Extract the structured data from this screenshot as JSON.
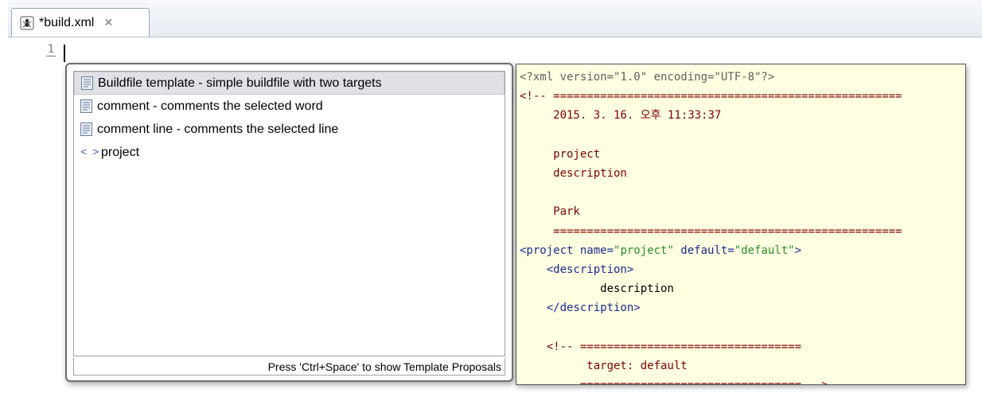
{
  "editor": {
    "tab_title": "*build.xml",
    "tab_close_glyph": "✕",
    "line_number": "1"
  },
  "proposals": {
    "items": [
      {
        "icon": "template-icon",
        "label": "Buildfile template - simple buildfile with two targets",
        "selected": true
      },
      {
        "icon": "template-icon",
        "label": "comment - comments the selected word",
        "selected": false
      },
      {
        "icon": "template-icon",
        "label": "comment line - comments the selected line",
        "selected": false
      },
      {
        "icon": "xml-tag-icon",
        "label": "project",
        "selected": false
      }
    ],
    "tag_icon_glyph": "< >",
    "status": "Press 'Ctrl+Space' to show Template Proposals"
  },
  "info": {
    "lines": [
      "<?xml version=\"1.0\" encoding=\"UTF-8\"?>",
      "<!-- ====================================================",
      "     2015. 3. 16. 오후 11:33:37",
      "",
      "     project",
      "     description",
      "",
      "     Park",
      "     ====================================================",
      "<project name=\"project\" default=\"default\">",
      "    <description>",
      "            description",
      "    </description>",
      "",
      "    <!-- =================================",
      "          target: default",
      "         ================================= -->"
    ]
  },
  "colors": {
    "selection": "#dfe1e6",
    "info_background": "#ffffe1",
    "comment": "#7f0000",
    "tag": "#1b2a8f",
    "attribute_value": "#2a8f2a"
  }
}
